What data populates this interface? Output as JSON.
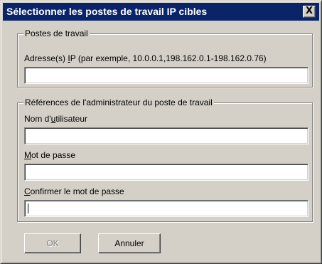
{
  "dialog": {
    "title": "Sélectionner les postes de travail IP cibles",
    "close_glyph": "X",
    "close_icon": "close-icon"
  },
  "workstations_group": {
    "legend": "Postes de travail",
    "ip_label_before": "Adresse(s) ",
    "ip_label_accel": "I",
    "ip_label_after": "P (par exemple, 10.0.0.1,198.162.0.1-198.162.0.76)",
    "ip_value": ""
  },
  "credentials_group": {
    "legend": "Références de l'administrateur du poste de travail",
    "username_label_before": "Nom d'",
    "username_label_accel": "u",
    "username_label_after": "tilisateur",
    "username_value": "",
    "password_label_accel": "M",
    "password_label_after": "ot de passe",
    "password_value": "",
    "confirm_label_accel": "C",
    "confirm_label_after": "onfirmer le mot de passe",
    "confirm_value": ""
  },
  "buttons": {
    "ok_label": "OK",
    "ok_enabled": false,
    "cancel_label": "Annuler"
  },
  "colors": {
    "title_bar": "#0a246a",
    "face": "#d4d0c8",
    "disabled_text": "#808080"
  }
}
